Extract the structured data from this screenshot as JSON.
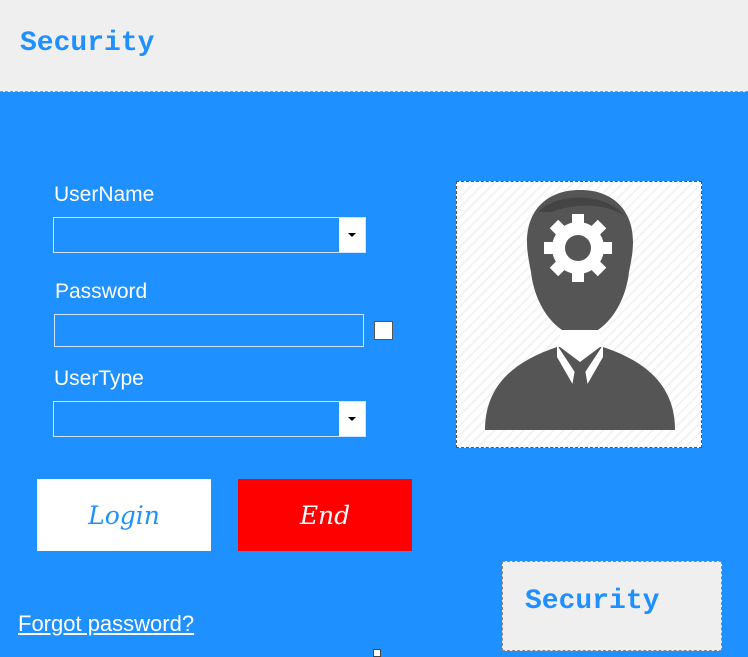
{
  "window": {
    "title": "Security"
  },
  "form": {
    "username_label": "UserName",
    "username_value": "",
    "password_label": "Password",
    "password_value": "",
    "usertype_label": "UserType",
    "usertype_value": ""
  },
  "buttons": {
    "login": "Login",
    "end": "End"
  },
  "links": {
    "forgot_password": "Forgot password?"
  },
  "badge": {
    "text": "Security"
  },
  "icons": {
    "avatar": "user-gear-icon",
    "dropdown": "chevron-down-icon"
  },
  "colors": {
    "background": "#1E90FF",
    "header": "#EFEFEF",
    "end_button": "#FF0000",
    "login_button": "#FFFFFF"
  }
}
